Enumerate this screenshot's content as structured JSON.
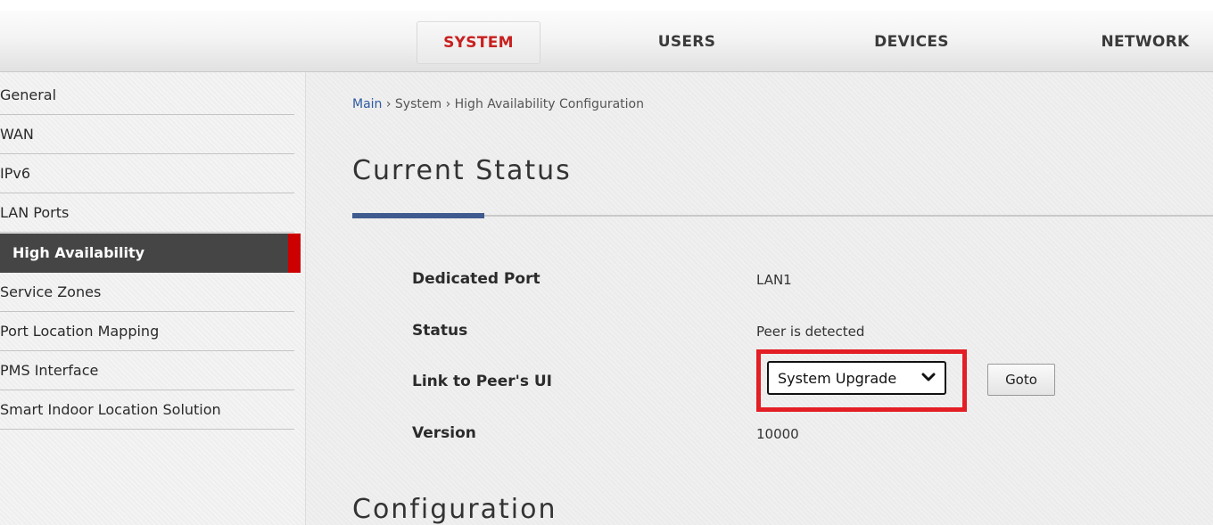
{
  "topnav": {
    "tabs": [
      {
        "label": "SYSTEM",
        "active": true
      },
      {
        "label": "USERS",
        "active": false
      },
      {
        "label": "DEVICES",
        "active": false
      },
      {
        "label": "NETWORK",
        "active": false
      }
    ]
  },
  "sidebar": {
    "items": [
      {
        "label": "General"
      },
      {
        "label": "WAN"
      },
      {
        "label": "IPv6"
      },
      {
        "label": "LAN Ports"
      },
      {
        "label": "High Availability",
        "active": true
      },
      {
        "label": "Service Zones"
      },
      {
        "label": "Port Location Mapping"
      },
      {
        "label": "PMS Interface"
      },
      {
        "label": "Smart Indoor Location Solution"
      }
    ]
  },
  "breadcrumb": {
    "main": "Main",
    "sep1": " › ",
    "system": "System",
    "sep2": " › ",
    "current": "High Availability Configuration"
  },
  "current_status": {
    "title": "Current Status",
    "rows": {
      "dedicated_port": {
        "label": "Dedicated Port",
        "value": "LAN1"
      },
      "status": {
        "label": "Status",
        "value": "Peer is detected"
      },
      "link_to_peer": {
        "label": "Link to Peer's UI",
        "selected": "System Upgrade",
        "button": "Goto"
      },
      "version": {
        "label": "Version",
        "value": "10000"
      }
    }
  },
  "configuration": {
    "title": "Configuration"
  },
  "colors": {
    "accent_red": "#c8201f",
    "highlight_red": "#e31e24",
    "active_sidebar_bg": "#454545",
    "title_accent_blue": "#3f5a8f"
  }
}
